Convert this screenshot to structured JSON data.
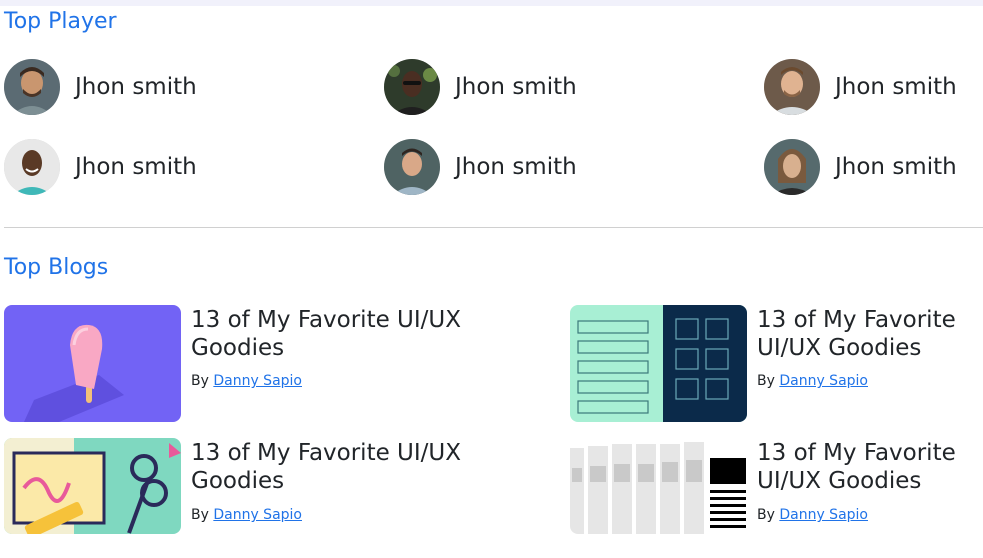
{
  "players_section": {
    "title": "Top Player",
    "players": [
      {
        "name": "Jhon smith",
        "avatar_bg": "#5b6b73"
      },
      {
        "name": "Jhon smith",
        "avatar_bg": "#2e3b2b"
      },
      {
        "name": "Jhon smith",
        "avatar_bg": "#6d5a4a"
      },
      {
        "name": "Jhon smith",
        "avatar_bg": "#e8e8e8"
      },
      {
        "name": "Jhon smith",
        "avatar_bg": "#4f6363"
      },
      {
        "name": "Jhon smith",
        "avatar_bg": "#566a6d"
      }
    ]
  },
  "blogs_section": {
    "title": "Top Blogs",
    "blogs": [
      {
        "title": "13 of My Favorite UI/UX Goodies",
        "by_label": "By",
        "author": "Danny Sapio",
        "thumb": "popsicle-illustration"
      },
      {
        "title": "13 of My Favorite UI/UX Goodies",
        "by_label": "By",
        "author": "Danny Sapio",
        "thumb": "wireframe-grid-illustration"
      },
      {
        "title": "13 of My Favorite UI/UX Goodies",
        "by_label": "By",
        "author": "Danny Sapio",
        "thumb": "scissors-crafts-illustration"
      },
      {
        "title": "13 of My Favorite UI/UX Goodies",
        "by_label": "By",
        "author": "Danny Sapio",
        "thumb": "original-documents-illustration"
      }
    ]
  },
  "colors": {
    "accent": "#2073e8",
    "text": "#212529",
    "divider": "#d0d0d0"
  }
}
